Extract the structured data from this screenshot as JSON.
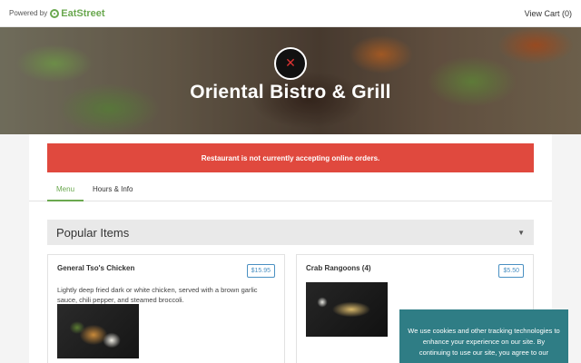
{
  "header": {
    "powered_by": "Powered by",
    "brand": "EatStreet",
    "view_cart": "View Cart (0)"
  },
  "hero": {
    "restaurant_name": "Oriental Bistro & Grill",
    "logo_icon": "restaurant-logo"
  },
  "alert": {
    "text": "Restaurant is not currently accepting online orders."
  },
  "tabs": [
    {
      "label": "Menu",
      "active": true
    },
    {
      "label": "Hours & Info",
      "active": false
    }
  ],
  "section": {
    "title": "Popular Items",
    "caret": "▼"
  },
  "items": [
    {
      "name": "General Tso's Chicken",
      "price": "$15.95",
      "description": "Lightly deep fried dark or white chicken, served with a brown garlic sauce, chili pepper, and steamed broccoli."
    },
    {
      "name": "Crab Rangoons (4)",
      "price": "$5.50",
      "description": ""
    }
  ],
  "cookie": {
    "text": "We use cookies and other tracking technologies to enhance your experience on our site. By continuing to use our site, you agree to our"
  },
  "colors": {
    "accent_green": "#6aa84f",
    "alert_red": "#e0493e",
    "price_blue": "#4a90c2",
    "cookie_teal": "#2f7d85"
  }
}
